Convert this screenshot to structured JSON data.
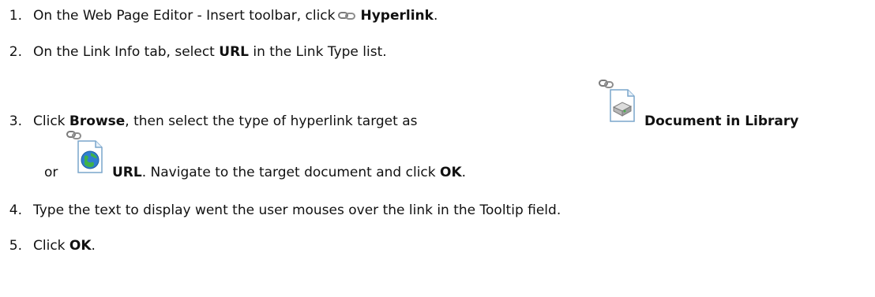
{
  "steps": [
    {
      "number": "1.",
      "text_before": "On the Web Page Editor - Insert toolbar, click",
      "bold": "Hyperlink",
      "text_after": "."
    },
    {
      "number": "2.",
      "text_before": "On the Link Info tab, select",
      "bold": "URL",
      "text_after": "in the Link Type list."
    },
    {
      "number": "3.",
      "text_click": "Click",
      "bold_browse": "Browse",
      "text_middle": ", then select the type of hyperlink target as",
      "bold_document": "Document in Library",
      "text_or": "or",
      "bold_url": "URL",
      "text_navigate": ". Navigate to the target document and click",
      "bold_ok": "OK",
      "text_end": "."
    },
    {
      "number": "4.",
      "text": "Type the text to display went the user mouses over the link in the Tooltip field."
    },
    {
      "number": "5.",
      "text_before": "Click",
      "bold": "OK",
      "text_after": "."
    }
  ],
  "icons": {
    "hyperlink": "chain-link-icon",
    "document_in_library": "library-document-link-icon",
    "url": "globe-document-link-icon"
  }
}
